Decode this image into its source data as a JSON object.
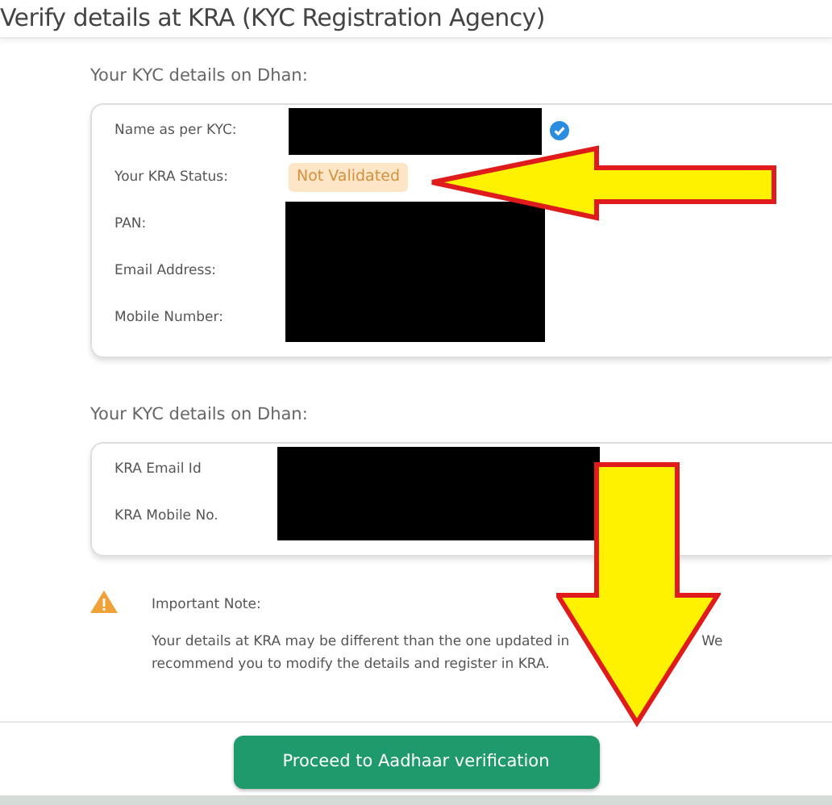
{
  "header": {
    "title": "Verify details at KRA (KYC Registration Agency)"
  },
  "sections": [
    {
      "heading": "Your KYC details on Dhan:",
      "rows": [
        {
          "label": "Name as per KYC:",
          "kind": "redacted",
          "verified": true
        },
        {
          "label": "Your KRA Status:",
          "kind": "badge",
          "value": "Not Validated"
        },
        {
          "label": "PAN:",
          "kind": "redacted"
        },
        {
          "label": "Email Address:",
          "kind": "redacted"
        },
        {
          "label": "Mobile Number:",
          "kind": "redacted"
        }
      ]
    },
    {
      "heading": "Your KYC details on Dhan:",
      "rows": [
        {
          "label": "KRA Email Id",
          "kind": "redacted"
        },
        {
          "label": "KRA Mobile No.",
          "kind": "redacted"
        }
      ]
    }
  ],
  "note": {
    "title": "Important Note:",
    "text_parts": [
      "Your details at KRA may be different than the one updated in",
      "We",
      "recommend you to modify the details and register in KRA."
    ]
  },
  "button": {
    "label": "Proceed to Aadhaar verification"
  }
}
